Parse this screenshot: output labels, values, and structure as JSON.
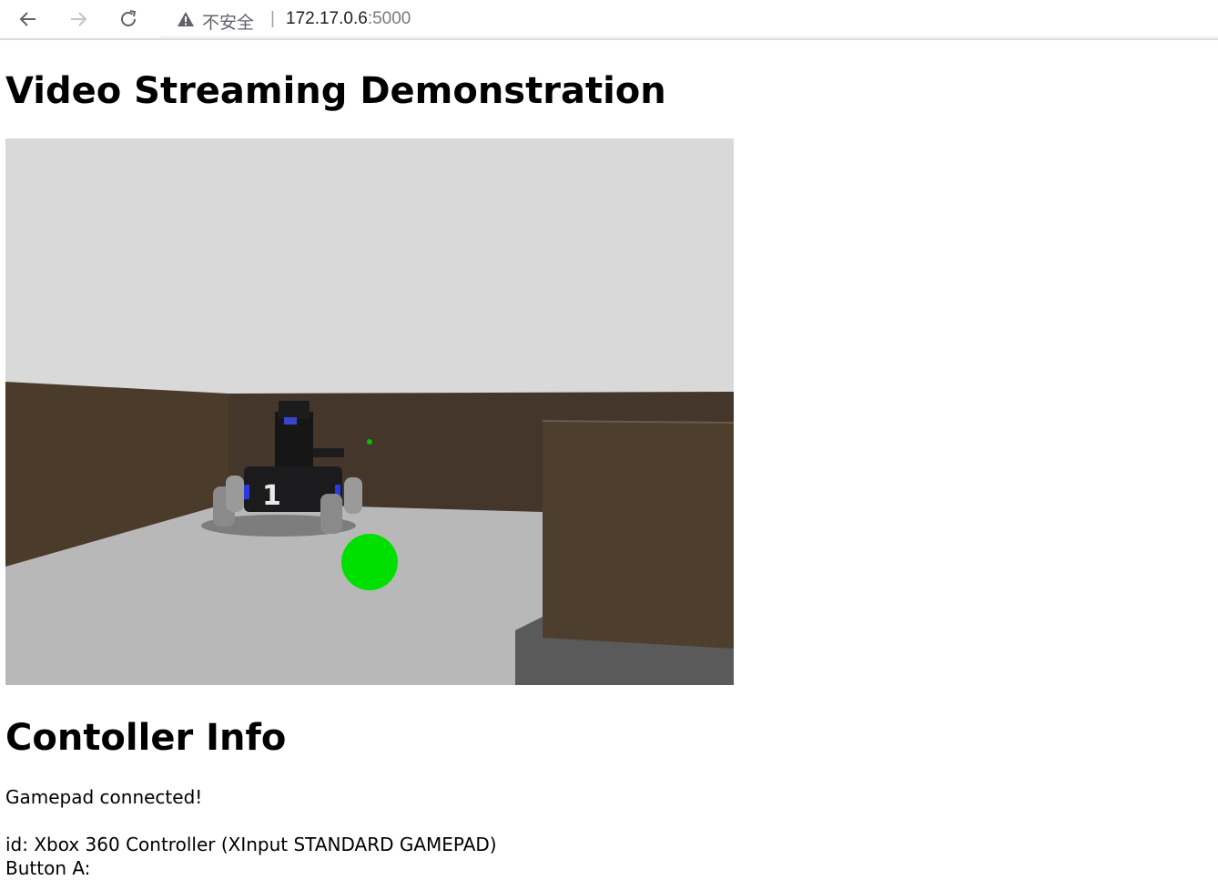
{
  "browser": {
    "security_label": "不安全",
    "separator": "|",
    "url_host": "172.17.0.6",
    "url_port": ":5000",
    "icons": [
      "back-arrow-icon",
      "forward-arrow-icon",
      "reload-icon",
      "warning-icon"
    ]
  },
  "page": {
    "title": "Video Streaming Demonstration",
    "video_alt": "Simulated robot camera stream",
    "controller_title": "Contoller Info",
    "status": "Gamepad connected!",
    "gamepad_id": "id: Xbox 360 Controller (XInput STANDARD GAMEPAD)",
    "button_a": "Button A:"
  },
  "colors": {
    "sky": "#d9d9d9",
    "floor": "#b8b8b8",
    "wall": "#4a3a2a",
    "ball": "#00e000"
  }
}
